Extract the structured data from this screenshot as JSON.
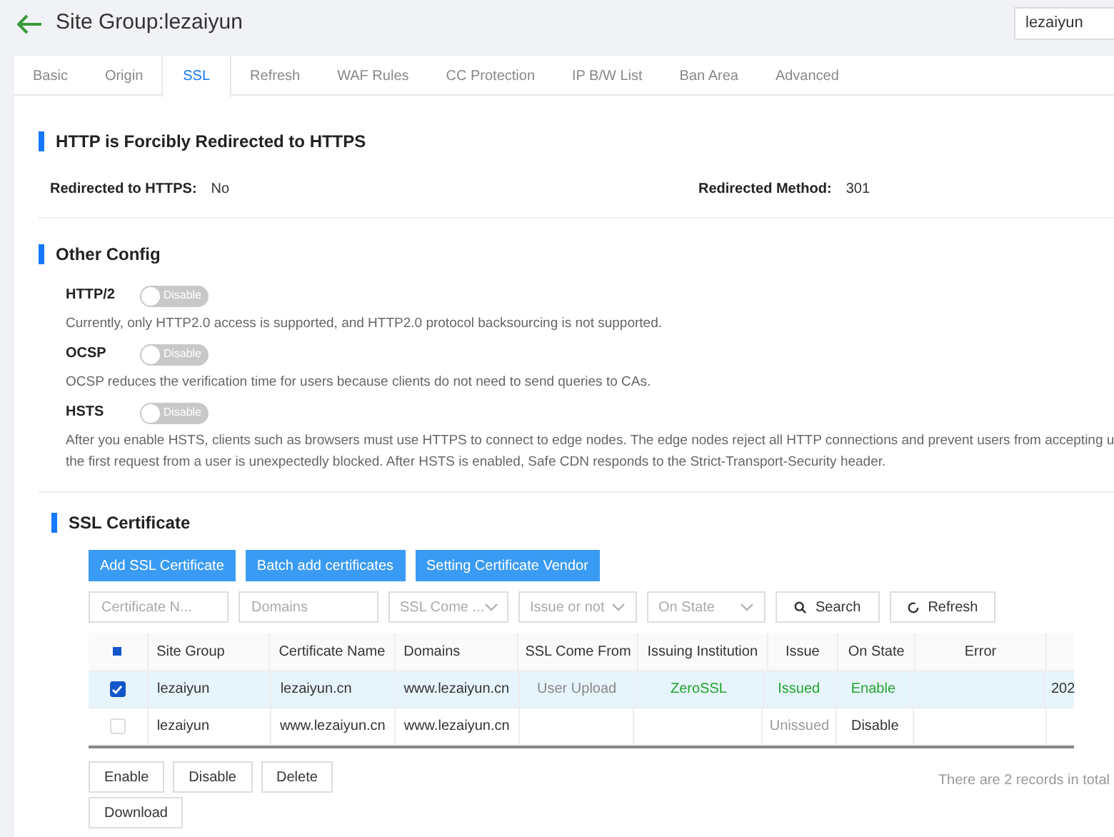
{
  "header": {
    "title": "Site Group:lezaiyun",
    "search_value": "lezaiyun"
  },
  "tabs": [
    {
      "label": "Basic",
      "selected": false
    },
    {
      "label": "Origin",
      "selected": false
    },
    {
      "label": "SSL",
      "selected": true
    },
    {
      "label": "Refresh",
      "selected": false
    },
    {
      "label": "WAF Rules",
      "selected": false
    },
    {
      "label": "CC Protection",
      "selected": false
    },
    {
      "label": "IP B/W List",
      "selected": false
    },
    {
      "label": "Ban Area",
      "selected": false
    },
    {
      "label": "Advanced",
      "selected": false
    }
  ],
  "redirect_section": {
    "title": "HTTP is Forcibly Redirected to HTTPS",
    "fields": [
      {
        "label": "Redirected to HTTPS:",
        "value": "No"
      },
      {
        "label": "Redirected Method:",
        "value": "301"
      }
    ]
  },
  "other_config": {
    "title": "Other Config",
    "items": [
      {
        "label": "HTTP/2",
        "on": false,
        "switch_text": "Disable",
        "description_lines": [
          "Currently, only HTTP2.0 access is supported, and HTTP2.0 protocol backsourcing is not supported."
        ]
      },
      {
        "label": "OCSP",
        "on": false,
        "switch_text": "Disable",
        "description_lines": [
          "OCSP reduces the verification time for users because clients do not need to send queries to CAs."
        ]
      },
      {
        "label": "HSTS",
        "on": false,
        "switch_text": "Disable",
        "description_lines": [
          "After you enable HSTS, clients such as browsers must use HTTPS to connect to edge nodes. The edge nodes reject all HTTP connections and prevent users from accepting u",
          "the first request from a user is unexpectedly blocked. After HSTS is enabled, Safe CDN responds to the Strict-Transport-Security header."
        ]
      }
    ]
  },
  "ssl_certificate": {
    "title": "SSL Certificate",
    "actions": [
      "Add SSL Certificate",
      "Batch add certificates",
      "Setting Certificate Vendor"
    ],
    "filters": [
      {
        "kind": "input",
        "placeholder": "Certificate N..."
      },
      {
        "kind": "input",
        "placeholder": "Domains"
      },
      {
        "kind": "select",
        "placeholder": "SSL Come ..."
      },
      {
        "kind": "select",
        "placeholder": "Issue or not"
      },
      {
        "kind": "select",
        "placeholder": "On State"
      }
    ],
    "search_button": "Search",
    "refresh_button": "Refresh",
    "table": {
      "header_checkbox_partial": true,
      "columns": [
        "Site Group",
        "Certificate Name",
        "Domains",
        "SSL Come From",
        "Issuing Institution",
        "Issue",
        "On State",
        "Error"
      ],
      "rows": [
        {
          "checked": true,
          "cells": [
            "lezaiyun",
            "lezaiyun.cn",
            "www.lezaiyun.cn",
            "User Upload",
            "ZeroSSL",
            "Issued",
            "Enable",
            "",
            "202"
          ],
          "issued": true,
          "enabled": true
        },
        {
          "checked": false,
          "cells": [
            "lezaiyun",
            "www.lezaiyun.cn",
            "www.lezaiyun.cn",
            "",
            "",
            "Unissued",
            "Disable",
            "",
            ""
          ],
          "issued": false,
          "enabled": false
        }
      ]
    },
    "bulk_buttons": [
      "Enable",
      "Disable",
      "Delete",
      "Download"
    ],
    "total": "There are 2 records in total"
  }
}
